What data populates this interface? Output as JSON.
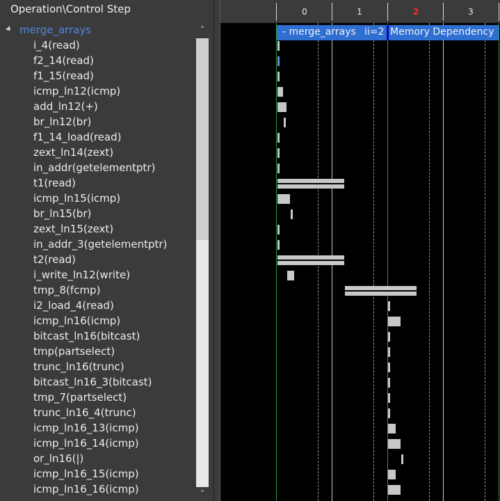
{
  "left_panel": {
    "header": "Operation\\Control Step",
    "root": "merge_arrays",
    "operations": [
      "i_4(read)",
      "f2_14(read)",
      "f1_15(read)",
      "icmp_ln12(icmp)",
      "add_ln12(+)",
      "br_ln12(br)",
      "f1_14_load(read)",
      "zext_ln14(zext)",
      "in_addr(getelementptr)",
      "t1(read)",
      "icmp_ln15(icmp)",
      "br_ln15(br)",
      "zext_ln15(zext)",
      "in_addr_3(getelementptr)",
      "t2(read)",
      "i_write_ln12(write)",
      "tmp_8(fcmp)",
      "i2_load_4(read)",
      "icmp_ln16(icmp)",
      "bitcast_ln16(bitcast)",
      "tmp(partselect)",
      "trunc_ln16(trunc)",
      "bitcast_ln16_3(bitcast)",
      "tmp_7(partselect)",
      "trunc_ln16_4(trunc)",
      "icmp_ln16_13(icmp)",
      "icmp_ln16_14(icmp)",
      "or_ln16(|)",
      "icmp_ln16_15(icmp)",
      "icmp_ln16_16(icmp)"
    ]
  },
  "scrollbar": {
    "up_icon": "chevron-up-icon",
    "down_icon": "chevron-down-icon"
  },
  "timeline": {
    "steps": [
      "0",
      "1",
      "2",
      "3"
    ],
    "active_step": "2",
    "region": {
      "name": "- merge_arrays",
      "ii": "ii=2",
      "label": "Memory Dependency"
    },
    "bar_color": "#c8c8c8",
    "region_color": "#2f6fd2",
    "active_step_color": "#ff2a2a"
  }
}
